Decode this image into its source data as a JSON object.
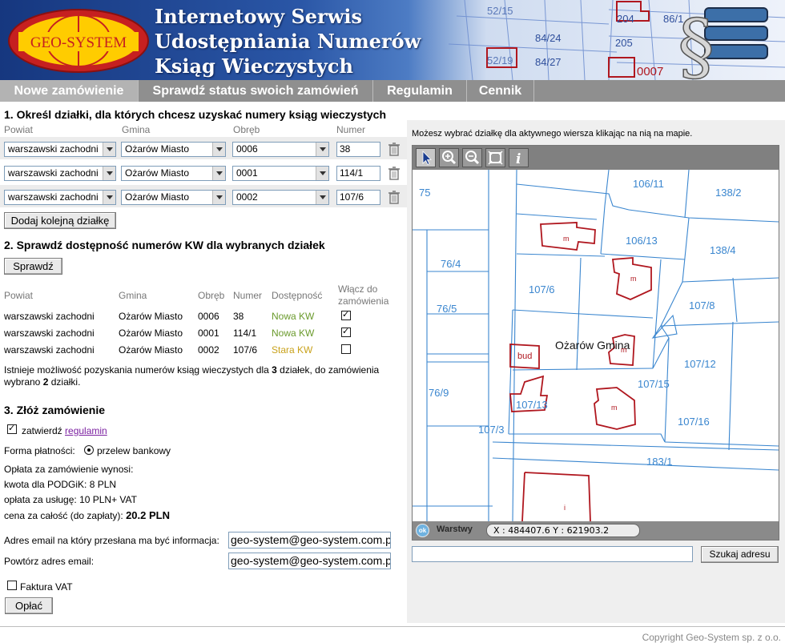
{
  "header": {
    "logo_text": "GEO-SYSTEM",
    "title_line1": "Internetowy Serwis",
    "title_line2": "Udostępniania Numerów",
    "title_line3": "Ksiąg Wieczystych",
    "map_labels": [
      "52/15",
      "204",
      "86/1",
      "205",
      "84/24",
      "52/19",
      "84/27",
      "0007"
    ]
  },
  "nav": {
    "tabs": [
      "Nowe zamówienie",
      "Sprawdź status swoich zamówień",
      "Regulamin",
      "Cennik"
    ]
  },
  "section1": {
    "heading": "1. Określ działki, dla których chcesz uzyskać numery ksiąg wieczystych",
    "col_powiat": "Powiat",
    "col_gmina": "Gmina",
    "col_obreb": "Obręb",
    "col_numer": "Numer",
    "rows": [
      {
        "powiat": "warszawski zachodni",
        "gmina": "Ożarów Miasto",
        "obreb": "0006",
        "numer": "38"
      },
      {
        "powiat": "warszawski zachodni",
        "gmina": "Ożarów Miasto",
        "obreb": "0001",
        "numer": "114/1"
      },
      {
        "powiat": "warszawski zachodni",
        "gmina": "Ożarów Miasto",
        "obreb": "0002",
        "numer": "107/6"
      }
    ],
    "add_button": "Dodaj kolejną działkę"
  },
  "section2": {
    "heading": "2. Sprawdź dostępność numerów KW dla wybranych działek",
    "check_button": "Sprawdź",
    "col_powiat": "Powiat",
    "col_gmina": "Gmina",
    "col_obreb": "Obręb",
    "col_numer": "Numer",
    "col_dostepnosc": "Dostępność",
    "col_wlacz_1": "Włącz do",
    "col_wlacz_2": "zamówienia",
    "rows": [
      {
        "powiat": "warszawski zachodni",
        "gmina": "Ożarów Miasto",
        "obreb": "0006",
        "numer": "38",
        "status": "Nowa KW"
      },
      {
        "powiat": "warszawski zachodni",
        "gmina": "Ożarów Miasto",
        "obreb": "0001",
        "numer": "114/1",
        "status": "Nowa KW"
      },
      {
        "powiat": "warszawski zachodni",
        "gmina": "Ożarów Miasto",
        "obreb": "0002",
        "numer": "107/6",
        "status": "Stara KW"
      }
    ],
    "checked": [
      true,
      true,
      false
    ],
    "status_colors": {
      "nowa": "#6a9a2c",
      "stara": "#c9a21c"
    },
    "info_1": "Istnieje możliwość pozyskania numerów ksiąg wieczystych dla ",
    "info_count_total": "3",
    "info_2": " działek, do zamówienia",
    "info_3": "wybrano ",
    "info_count_selected": "2",
    "info_4": " działki."
  },
  "section3": {
    "heading": "3. Złóż zamówienie",
    "confirm_label": "zatwierdź",
    "regulamin_link": "regulamin",
    "payment_form_label": "Forma płatności:",
    "payment_option": "przelew bankowy",
    "fee_line1": "Opłata za zamówienie wynosi:",
    "fee_line2": "kwota dla PODGiK: 8 PLN",
    "fee_line3": "opłata za usługę: 10 PLN+ VAT",
    "total_label": "cena za całość (do zapłaty): ",
    "total_value": "20.2 PLN",
    "email_label": "Adres email na który przesłana ma być informacja:",
    "email_value": "geo-system@geo-system.com.pl",
    "email_repeat_label": "Powtórz adres email:",
    "email_repeat_value": "geo-system@geo-system.com.pl",
    "invoice_label": "Faktura VAT",
    "pay_button": "Opłać"
  },
  "map": {
    "hint": "Możesz wybrać działkę dla aktywnego wiersza klikając na nią na mapie.",
    "parcel_labels": [
      "75",
      "106/11",
      "138/2",
      "106/13",
      "138/4",
      "76/4",
      "107/6",
      "107/8",
      "76/5",
      "Ożarów Gmina",
      "bud",
      "107/12",
      "107/15",
      "76/9",
      "107/13",
      "107/16",
      "107/3",
      "183/1"
    ],
    "building_marks": [
      "m",
      "m",
      "m",
      "m",
      "i"
    ],
    "layers_label": "Warstwy",
    "ok_label": "ok",
    "coordinates": "X : 484407.6  Y : 621903.2",
    "search_button": "Szukaj adresu",
    "parcel_color": "#3a86cf",
    "building_color": "#b0171f"
  },
  "footer": {
    "copyright": "Copyright Geo-System sp. z o.o."
  }
}
